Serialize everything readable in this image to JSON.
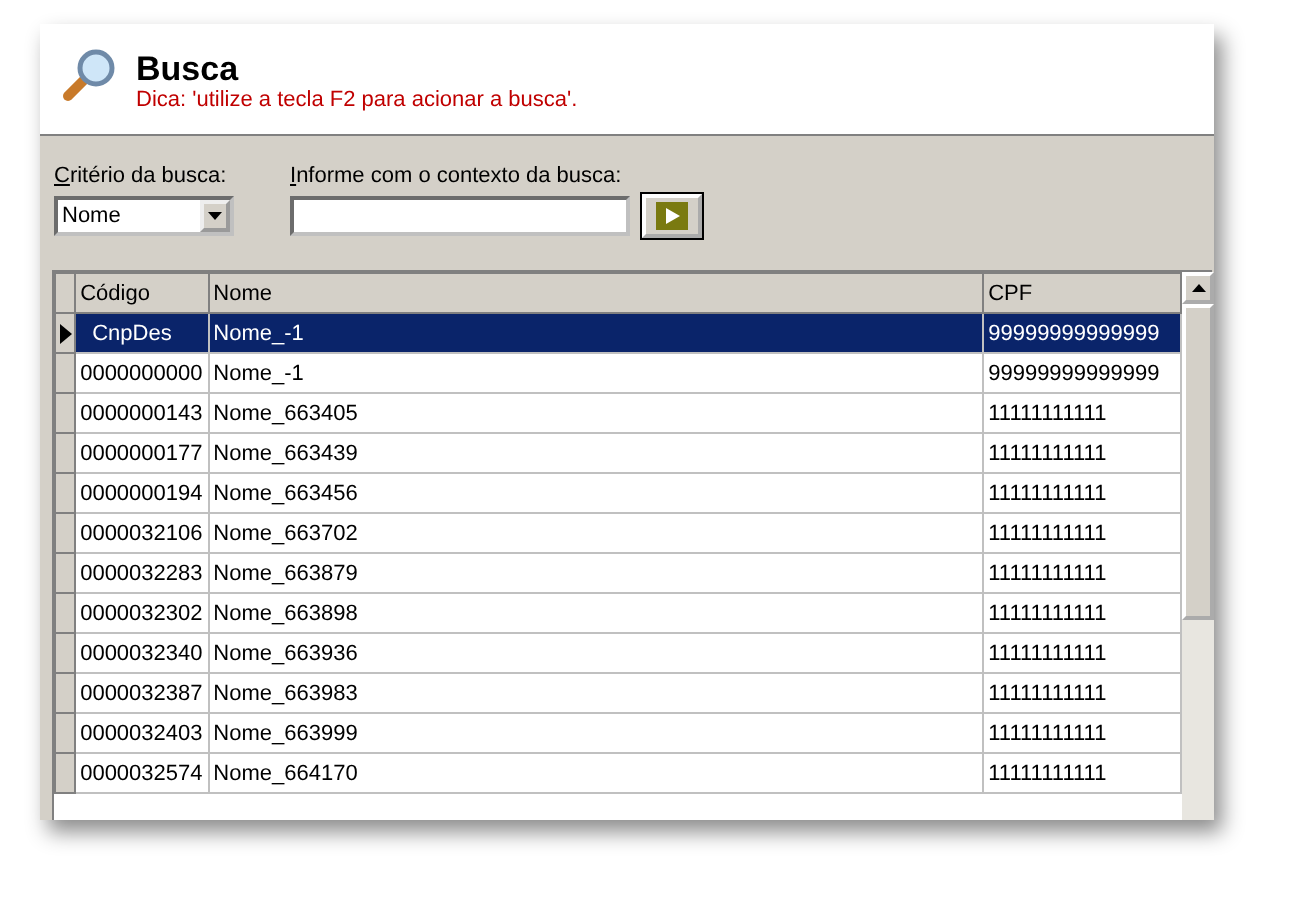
{
  "header": {
    "title": "Busca",
    "hint": "Dica: 'utilize a tecla F2 para acionar a busca'."
  },
  "criteria": {
    "label": "Critério da busca:",
    "value": "Nome"
  },
  "context": {
    "label": "Informe com o contexto da busca:"
  },
  "table": {
    "columns": [
      "Código",
      "Nome",
      "CPF"
    ],
    "rows": [
      {
        "cells": [
          "CnpDes",
          "Nome_-1",
          "99999999999999"
        ],
        "selected": true
      },
      {
        "cells": [
          "0000000000",
          "Nome_-1",
          "99999999999999"
        ],
        "selected": false
      },
      {
        "cells": [
          "0000000143",
          "Nome_663405",
          "11111111111"
        ],
        "selected": false
      },
      {
        "cells": [
          "0000000177",
          "Nome_663439",
          "11111111111"
        ],
        "selected": false
      },
      {
        "cells": [
          "0000000194",
          "Nome_663456",
          "11111111111"
        ],
        "selected": false
      },
      {
        "cells": [
          "0000032106",
          "Nome_663702",
          "11111111111"
        ],
        "selected": false
      },
      {
        "cells": [
          "0000032283",
          "Nome_663879",
          "11111111111"
        ],
        "selected": false
      },
      {
        "cells": [
          "0000032302",
          "Nome_663898",
          "11111111111"
        ],
        "selected": false
      },
      {
        "cells": [
          "0000032340",
          "Nome_663936",
          "11111111111"
        ],
        "selected": false
      },
      {
        "cells": [
          "0000032387",
          "Nome_663983",
          "11111111111"
        ],
        "selected": false
      },
      {
        "cells": [
          "0000032403",
          "Nome_663999",
          "11111111111"
        ],
        "selected": false
      },
      {
        "cells": [
          "0000032574",
          "Nome_664170",
          "11111111111"
        ],
        "selected": false
      }
    ]
  }
}
